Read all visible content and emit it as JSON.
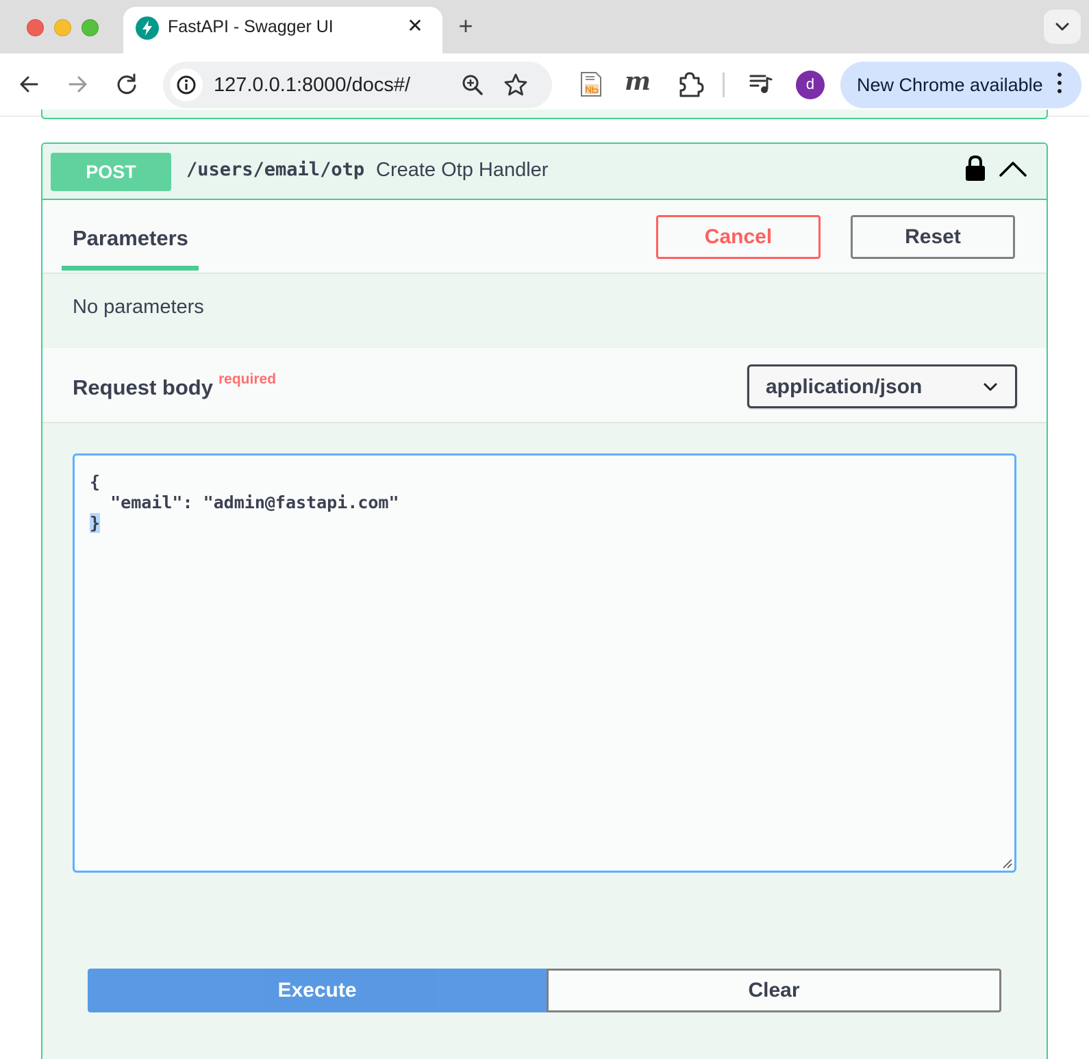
{
  "browser": {
    "tab": {
      "title": "FastAPI - Swagger UI",
      "favicon": "fastapi-logo-icon",
      "close_glyph": "✕"
    },
    "new_tab_glyph": "+",
    "address_bar": {
      "url": "127.0.0.1:8000/docs#/"
    },
    "profile_initial": "d",
    "update_button_label": "New Chrome available",
    "icons": [
      "back-arrow-icon",
      "forward-arrow-icon",
      "reload-icon",
      "site-info-icon",
      "zoom-icon",
      "bookmark-star-icon",
      "jupyter-notebook-extension-icon",
      "m-extension-icon",
      "extensions-puzzle-icon",
      "media-controls-icon",
      "more-vert-icon",
      "tab-search-chevron-icon"
    ],
    "extension_m_label": "m"
  },
  "operation": {
    "method": "POST",
    "path": "/users/email/otp",
    "summary": "Create Otp Handler",
    "method_color": "#49cc90",
    "icons": [
      "lock-icon",
      "chevron-up-icon"
    ]
  },
  "parameters_section": {
    "tab_label": "Parameters",
    "cancel_label": "Cancel",
    "reset_label": "Reset",
    "empty_text": "No parameters"
  },
  "request_body": {
    "title": "Request body",
    "required_label": "required",
    "content_type": "application/json",
    "editor_lines": [
      "{",
      "  \"email\": \"admin@fastapi.com\"",
      "}"
    ]
  },
  "actions": {
    "execute_label": "Execute",
    "clear_label": "Clear",
    "execute_color": "#4990e2"
  }
}
